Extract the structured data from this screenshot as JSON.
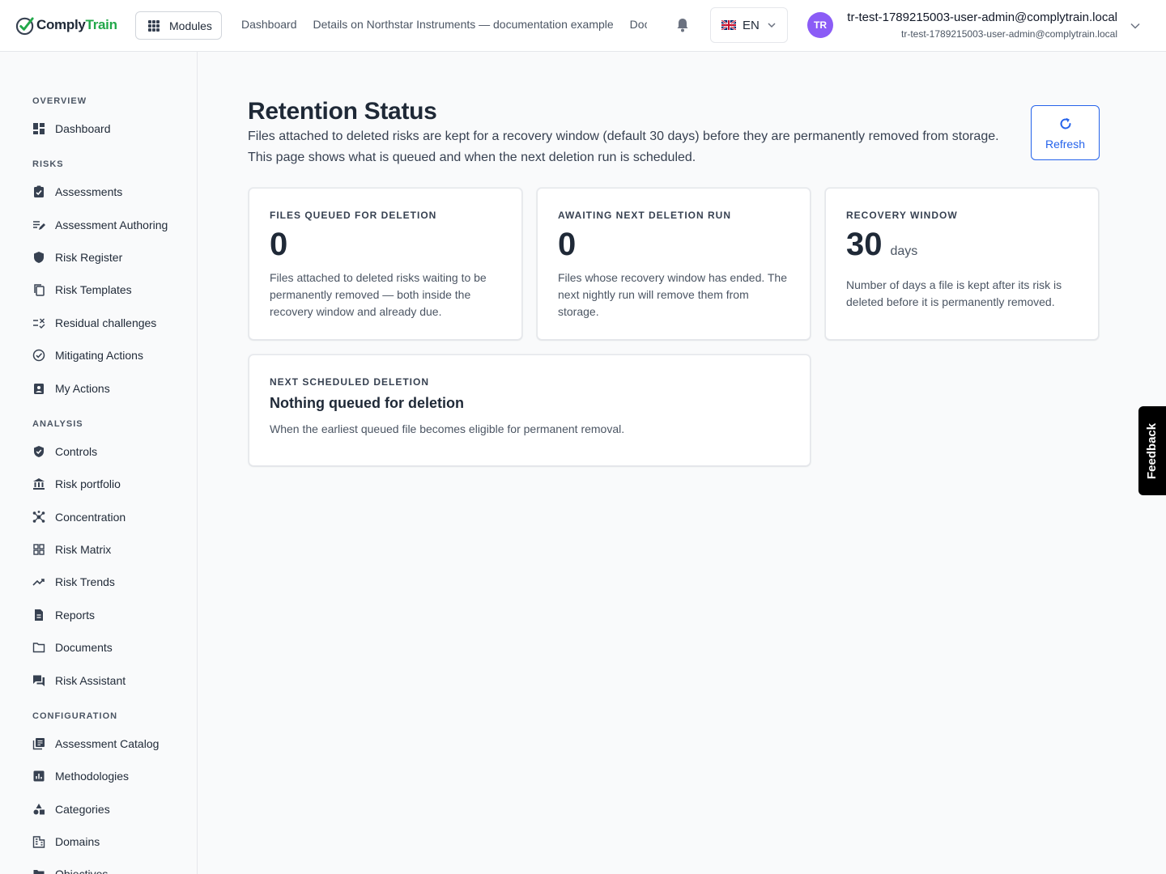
{
  "brand": {
    "comply": "Comply",
    "train": "Train",
    "accent": "#22a84a"
  },
  "topbar": {
    "modules_label": "Modules",
    "breadcrumbs": [
      "Dashboard",
      "Details on Northstar Instruments — documentation example",
      "Documents"
    ],
    "language": "EN",
    "avatar_initials": "TR",
    "user_name": "tr-test-1789215003-user-admin@complytrain.local",
    "user_email": "tr-test-1789215003-user-admin@complytrain.local"
  },
  "sidebar": {
    "sections": [
      {
        "title": "OVERVIEW",
        "items": [
          {
            "label": "Dashboard",
            "icon": "dashboard-icon"
          }
        ]
      },
      {
        "title": "RISKS",
        "items": [
          {
            "label": "Assessments",
            "icon": "assessment-icon"
          },
          {
            "label": "Assessment Authoring",
            "icon": "edit-note-icon"
          },
          {
            "label": "Risk Register",
            "icon": "shield-icon"
          },
          {
            "label": "Risk Templates",
            "icon": "copy-icon"
          },
          {
            "label": "Residual challenges",
            "icon": "rule-icon"
          },
          {
            "label": "Mitigating Actions",
            "icon": "check-circle-icon"
          },
          {
            "label": "My Actions",
            "icon": "clipboard-user-icon"
          }
        ]
      },
      {
        "title": "ANALYSIS",
        "items": [
          {
            "label": "Controls",
            "icon": "verified-shield-icon"
          },
          {
            "label": "Risk portfolio",
            "icon": "bank-icon"
          },
          {
            "label": "Concentration",
            "icon": "hub-icon"
          },
          {
            "label": "Risk Matrix",
            "icon": "grid-icon"
          },
          {
            "label": "Risk Trends",
            "icon": "trending-icon"
          },
          {
            "label": "Reports",
            "icon": "report-icon"
          },
          {
            "label": "Documents",
            "icon": "folder-icon"
          },
          {
            "label": "Risk Assistant",
            "icon": "chat-icon"
          }
        ]
      },
      {
        "title": "CONFIGURATION",
        "items": [
          {
            "label": "Assessment Catalog",
            "icon": "catalog-icon"
          },
          {
            "label": "Methodologies",
            "icon": "chart-box-icon"
          },
          {
            "label": "Categories",
            "icon": "category-icon"
          },
          {
            "label": "Domains",
            "icon": "building-icon"
          },
          {
            "label": "Objectives",
            "icon": "folder-icon"
          }
        ]
      }
    ]
  },
  "main": {
    "title": "Retention Status",
    "description": "Files attached to deleted risks are kept for a recovery window (default 30 days) before they are permanently removed from storage. This page shows what is queued and when the next deletion run is scheduled.",
    "refresh_label": "Refresh",
    "cards": [
      {
        "label": "FILES QUEUED FOR DELETION",
        "value": "0",
        "text": "Files attached to deleted risks waiting to be permanently removed — both inside the recovery window and already due."
      },
      {
        "label": "AWAITING NEXT DELETION RUN",
        "value": "0",
        "text": "Files whose recovery window has ended. The next nightly run will remove them from storage."
      },
      {
        "label": "RECOVERY WINDOW",
        "value": "30",
        "unit": "days",
        "text": "Number of days a file is kept after its risk is deleted before it is permanently removed."
      }
    ],
    "next_deletion": {
      "label": "NEXT SCHEDULED DELETION",
      "heading": "Nothing queued for deletion",
      "text": "When the earliest queued file becomes eligible for permanent removal."
    }
  },
  "feedback_label": "Feedback",
  "colors": {
    "primary": "#2563eb",
    "avatar": "#8b5cf6"
  }
}
